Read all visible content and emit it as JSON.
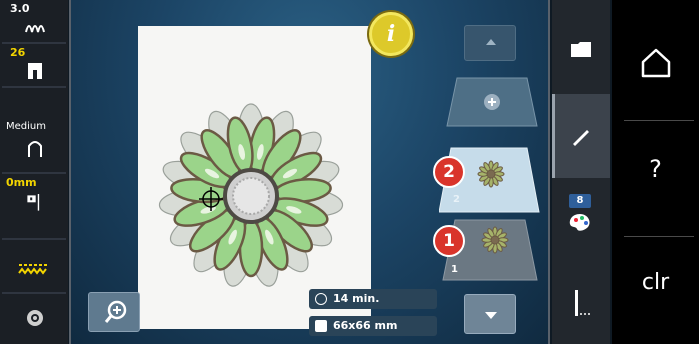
{
  "left_panel": {
    "tension_value": "3.0",
    "stitch_length_value": "26",
    "presser_foot_label": "Medium",
    "needle_position_value": "0mm"
  },
  "canvas": {
    "design": "daisy-flower-embroidery"
  },
  "info_button": {
    "label": "i"
  },
  "stats": {
    "time": "14 min.",
    "size": "66x66 mm"
  },
  "layers": [
    {
      "badge": "2",
      "number": "2"
    },
    {
      "badge": "1",
      "number": "1"
    }
  ],
  "tools": {
    "hoop_badge": "8"
  },
  "system": {
    "help_label": "?",
    "clear_label": "clr"
  },
  "colors": {
    "accent_yellow": "#f2d400",
    "badge_red": "#d9342b",
    "info_button": "#ddc92a"
  }
}
